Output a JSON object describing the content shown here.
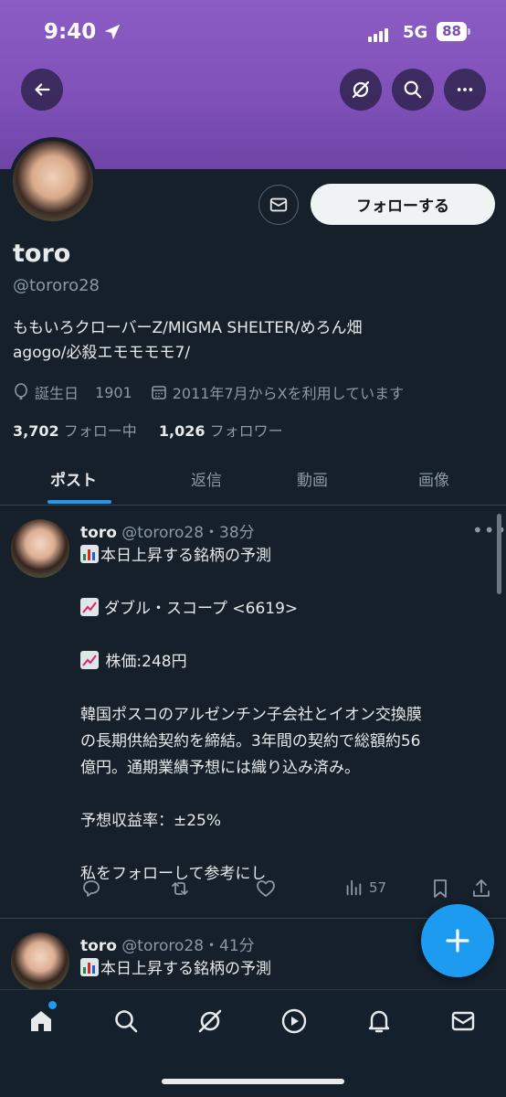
{
  "status": {
    "time": "9:40",
    "network": "5G",
    "battery": "88"
  },
  "profile": {
    "name": "toro",
    "handle": "@tororo28",
    "bio_line1": "ももいろクローバーZ/MIGMA SHELTER/めろん畑",
    "bio_line2": "agogo/必殺エモモモモ7/",
    "birthday_label": "誕生日",
    "birthday_value": "1901",
    "joined": "2011年7月からXを利用しています",
    "following_count": "3,702",
    "following_label": "フォロー中",
    "followers_count": "1,026",
    "followers_label": "フォロワー",
    "follow_button": "フォローする"
  },
  "tabs": [
    {
      "label": "ポスト",
      "active": true
    },
    {
      "label": "返信",
      "active": false
    },
    {
      "label": "動画",
      "active": false
    },
    {
      "label": "画像",
      "active": false
    }
  ],
  "posts": [
    {
      "name": "toro",
      "meta": "@tororo28・38分",
      "lines": [
        "本日上昇する銘柄の予測",
        "",
        "ダブル・スコープ <6619>",
        "",
        " 株価:248円",
        "",
        "韓国ポスコのアルゼンチン子会社とイオン交換膜",
        "の長期供給契約を締結。3年間の契約で総額約56",
        "億円。通期業績予想には織り込み済み。",
        "",
        "予想収益率：±25%",
        "",
        "私をフォローして参考にし"
      ],
      "views": "57"
    },
    {
      "name": "toro",
      "meta": "@tororo28・41分",
      "lines": [
        "本日上昇する銘柄の予測"
      ]
    }
  ],
  "icons": {
    "back": "back-arrow-icon",
    "grok": "grok-icon",
    "search": "search-icon",
    "more": "more-icon",
    "message": "mail-icon",
    "compose": "plus-icon"
  },
  "colors": {
    "accent": "#1d9bf0",
    "background": "#15202b",
    "banner": "#7e50b8"
  }
}
